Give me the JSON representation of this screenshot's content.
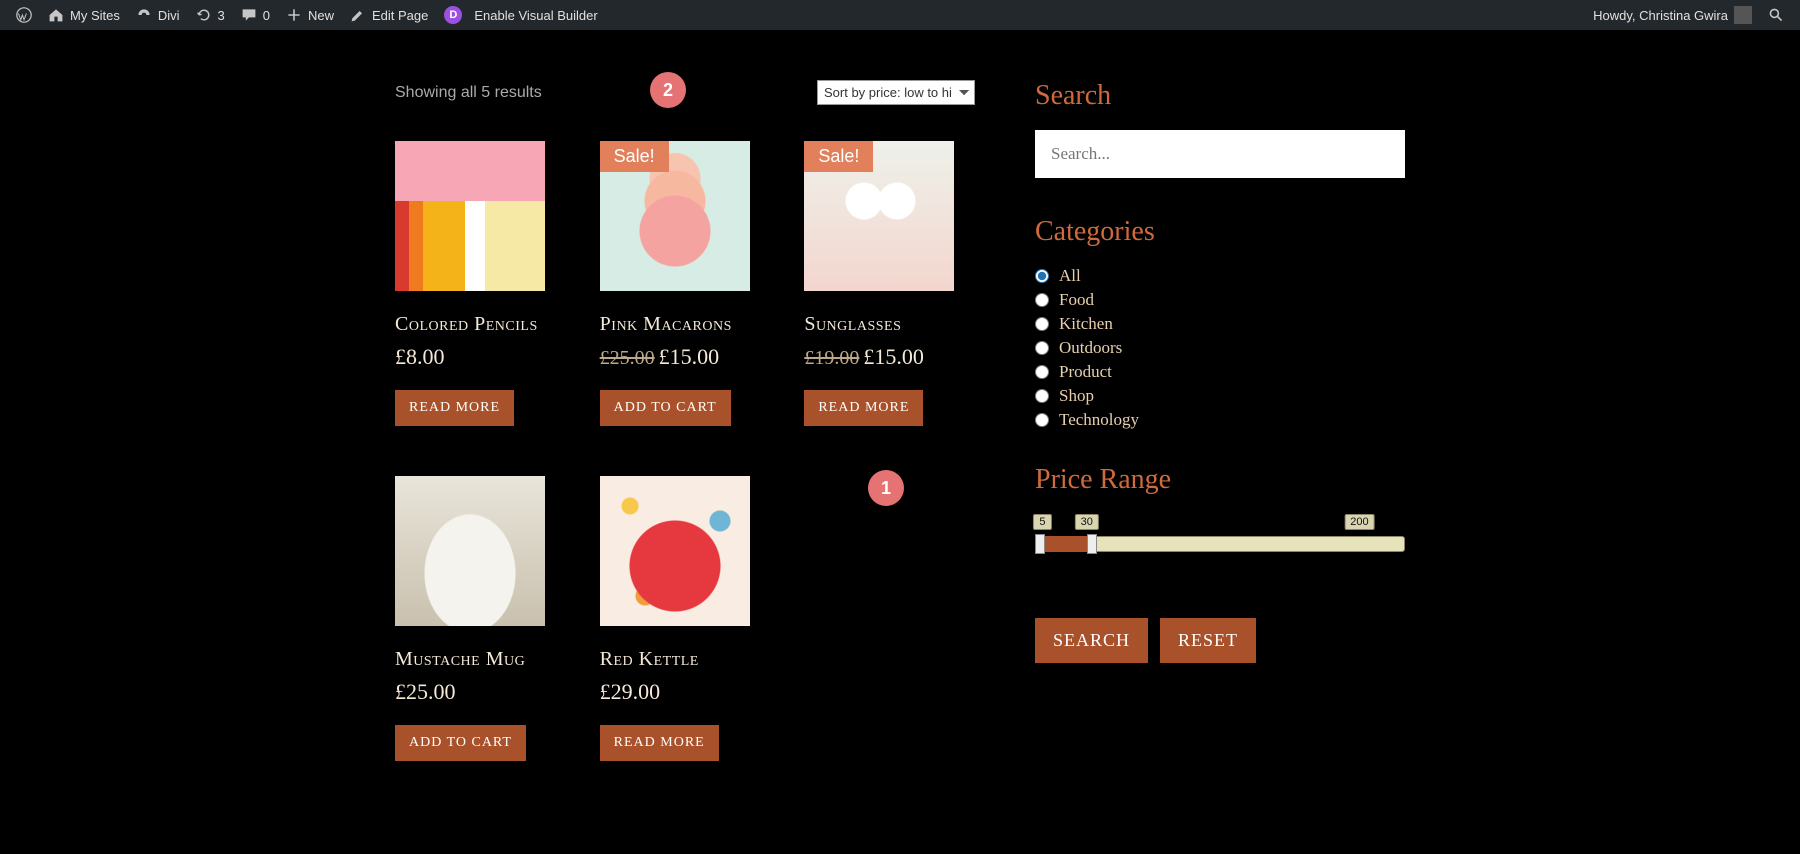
{
  "adminbar": {
    "my_sites": "My Sites",
    "divi": "Divi",
    "updates": "3",
    "comments": "0",
    "new": "New",
    "edit_page": "Edit Page",
    "visual_builder": "Enable Visual Builder",
    "howdy": "Howdy, Christina Gwira"
  },
  "results_text": "Showing all 5 results",
  "sort_label": "Sort by price: low to high",
  "pin1": "1",
  "pin2": "2",
  "sale_label": "Sale!",
  "read_more": "READ MORE",
  "add_to_cart": "ADD TO CART",
  "products": [
    {
      "name": "Colored Pencils",
      "price": "£8.00",
      "old": "",
      "sale": false,
      "action": "read_more",
      "imgclass": "pencils"
    },
    {
      "name": "Pink Macarons",
      "price": "£15.00",
      "old": "£25.00",
      "sale": true,
      "action": "add_to_cart",
      "imgclass": "macarons"
    },
    {
      "name": "Sunglasses",
      "price": "£15.00",
      "old": "£19.00",
      "sale": true,
      "action": "read_more",
      "imgclass": "sunglasses"
    },
    {
      "name": "Mustache Mug",
      "price": "£25.00",
      "old": "",
      "sale": false,
      "action": "add_to_cart",
      "imgclass": "mug"
    },
    {
      "name": "Red Kettle",
      "price": "£29.00",
      "old": "",
      "sale": false,
      "action": "read_more",
      "imgclass": "kettle"
    }
  ],
  "sidebar": {
    "search_heading": "Search",
    "search_placeholder": "Search...",
    "categories_heading": "Categories",
    "categories": [
      "All",
      "Food",
      "Kitchen",
      "Outdoors",
      "Product",
      "Shop",
      "Technology"
    ],
    "selected_category": "All",
    "price_heading": "Price Range",
    "price": {
      "low": "5",
      "mid": "30",
      "high": "200",
      "low_pct": 0,
      "mid_pct": 14,
      "high_pct": 100
    },
    "search_btn": "SEARCH",
    "reset_btn": "RESET"
  }
}
